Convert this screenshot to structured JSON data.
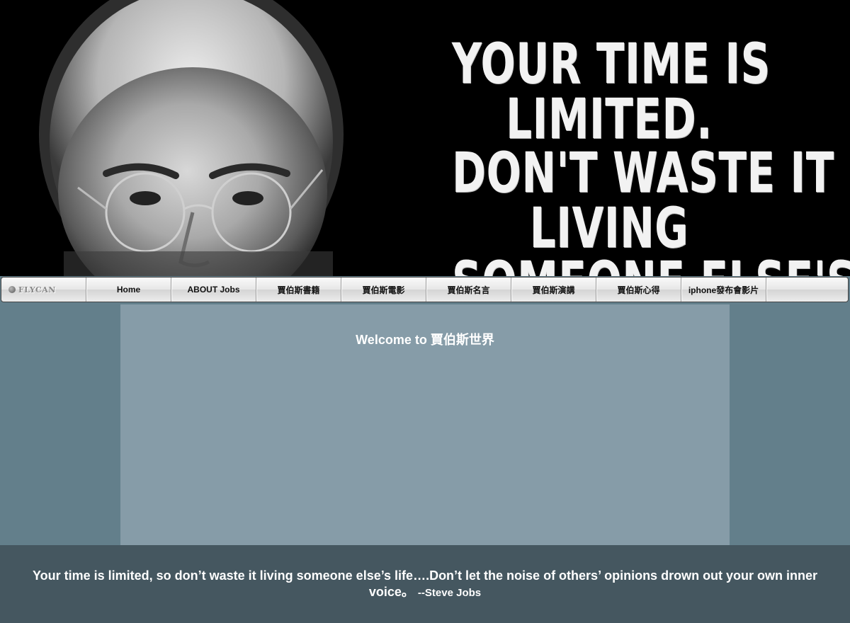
{
  "banner": {
    "quote_lines": [
      "YOUR TIME IS",
      "LIMITED.",
      "DON'T WASTE IT",
      "LIVING",
      "SOMEONE ELSE'S"
    ]
  },
  "nav": {
    "logo_text": "FLYCAN",
    "items": [
      {
        "label": "Home"
      },
      {
        "label": "ABOUT Jobs"
      },
      {
        "label": "賈伯斯書籍"
      },
      {
        "label": "賈伯斯電影"
      },
      {
        "label": "賈伯斯名言"
      },
      {
        "label": "賈伯斯演講"
      },
      {
        "label": "賈伯斯心得"
      },
      {
        "label": "iphone發布會影片"
      }
    ]
  },
  "main": {
    "welcome": "Welcome to 賈伯斯世界"
  },
  "footer": {
    "quote": "Your time is limited, so don’t waste it living someone else’s life….Don’t let the noise of others’ opinions drown out your own inner voice。",
    "author": "--Steve Jobs"
  },
  "colors": {
    "page_background": "#637f8b",
    "content_background": "#869ca8",
    "footer_background": "#455760",
    "banner_background": "#000000"
  }
}
